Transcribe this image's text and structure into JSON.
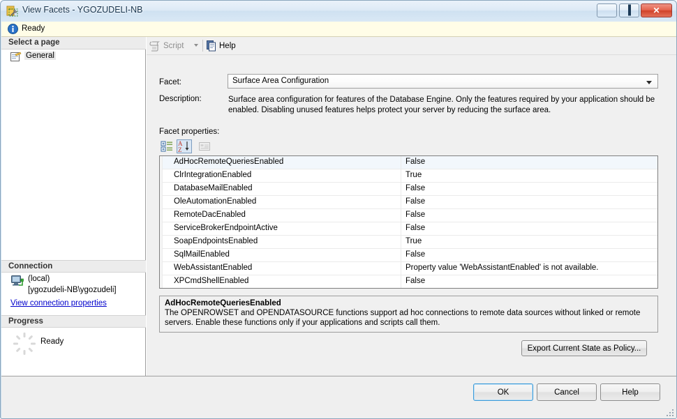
{
  "window": {
    "title": "View Facets - YGOZUDELI-NB",
    "icon": "facet-window-icon",
    "controls": {
      "minimize": "minimize-button",
      "maximize": "maximize-button",
      "close": "close-button"
    }
  },
  "infobar": {
    "icon": "info-icon",
    "text": "Ready"
  },
  "sidebar": {
    "select_page_header": "Select a page",
    "pages": [
      {
        "label": "General",
        "icon": "page-general-icon",
        "selected": true
      }
    ],
    "connection": {
      "header": "Connection",
      "icon": "server-connection-icon",
      "server": "(local)",
      "user": "[ygozudeli-NB\\ygozudeli]",
      "link": "View connection properties"
    },
    "progress": {
      "header": "Progress",
      "icon": "progress-spinner-icon",
      "status": "Ready"
    }
  },
  "toolbar": {
    "script_label": "Script",
    "script_icon": "script-icon",
    "script_dropdown_icon": "chevron-down-icon",
    "help_label": "Help",
    "help_icon": "help-icon"
  },
  "main": {
    "facet_label": "Facet:",
    "facet_value": "Surface Area Configuration",
    "facet_dropdown_icon": "chevron-down-icon",
    "description_label": "Description:",
    "description_text": "Surface area configuration for features of the Database Engine. Only the features required by your application should be enabled. Disabling unused features helps protect your server by reducing the surface area.",
    "facet_properties_label": "Facet properties:",
    "grid_toolbar": [
      {
        "name": "categorized-view-button",
        "icon": "categorized-icon",
        "pressed": false,
        "enabled": true
      },
      {
        "name": "alphabetical-view-button",
        "icon": "sort-alpha-icon",
        "pressed": true,
        "enabled": true
      },
      {
        "name": "property-pages-button",
        "icon": "property-pages-icon",
        "pressed": false,
        "enabled": false
      }
    ],
    "properties": [
      {
        "name": "AdHocRemoteQueriesEnabled",
        "value": "False",
        "selected": true
      },
      {
        "name": "ClrIntegrationEnabled",
        "value": "True",
        "selected": false
      },
      {
        "name": "DatabaseMailEnabled",
        "value": "False",
        "selected": false
      },
      {
        "name": "OleAutomationEnabled",
        "value": "False",
        "selected": false
      },
      {
        "name": "RemoteDacEnabled",
        "value": "False",
        "selected": false
      },
      {
        "name": "ServiceBrokerEndpointActive",
        "value": "False",
        "selected": false
      },
      {
        "name": "SoapEndpointsEnabled",
        "value": "True",
        "selected": false
      },
      {
        "name": "SqlMailEnabled",
        "value": "False",
        "selected": false
      },
      {
        "name": "WebAssistantEnabled",
        "value": "Property value 'WebAssistantEnabled' is not available.",
        "selected": false
      },
      {
        "name": "XPCmdShellEnabled",
        "value": "False",
        "selected": false
      }
    ],
    "help_pane": {
      "title": "AdHocRemoteQueriesEnabled",
      "body": "The OPENROWSET and OPENDATASOURCE functions support ad hoc connections to remote data sources without linked or remote servers. Enable these functions only if your applications and scripts call them."
    },
    "export_button": "Export Current State as Policy..."
  },
  "footer": {
    "ok": "OK",
    "cancel": "Cancel",
    "help": "Help"
  },
  "colors": {
    "accent": "#3c9ad8",
    "infobar_bg": "#fffde7",
    "selected_row": "#f2f7fc",
    "link": "#0000cc"
  }
}
